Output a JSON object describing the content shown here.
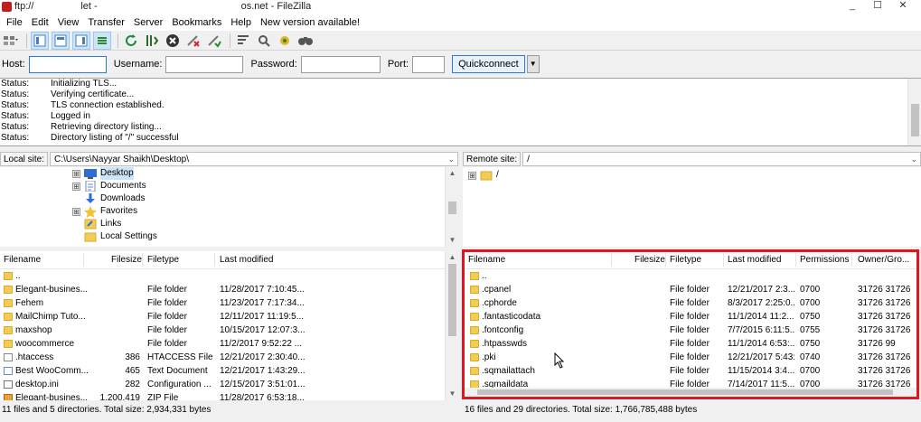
{
  "window": {
    "title": "ftp://                 let -                                                    os.net - FileZilla",
    "buttons": [
      "_",
      "☐",
      "✕"
    ]
  },
  "menu": [
    "File",
    "Edit",
    "View",
    "Transfer",
    "Server",
    "Bookmarks",
    "Help",
    "New version available!"
  ],
  "quickconnect": {
    "host_label": "Host:",
    "username_label": "Username:",
    "password_label": "Password:",
    "port_label": "Port:",
    "host_value": "",
    "username_value": "",
    "password_value": "",
    "port_value": "",
    "button_label": "Quickconnect",
    "dropdown_glyph": "▼"
  },
  "log": [
    {
      "label": "Status:",
      "text": "Initializing TLS..."
    },
    {
      "label": "Status:",
      "text": "Verifying certificate..."
    },
    {
      "label": "Status:",
      "text": "TLS connection established."
    },
    {
      "label": "Status:",
      "text": "Logged in"
    },
    {
      "label": "Status:",
      "text": "Retrieving directory listing..."
    },
    {
      "label": "Status:",
      "text": "Directory listing of \"/\" successful"
    }
  ],
  "local": {
    "site_label": "Local site:",
    "path": "C:\\Users\\Nayyar Shaikh\\Desktop\\",
    "tree": [
      {
        "label": "Desktop",
        "expander": "⊞",
        "icon": "desktop-icon"
      },
      {
        "label": "Documents",
        "expander": "⊞",
        "icon": "documents-icon"
      },
      {
        "label": "Downloads",
        "expander": "",
        "icon": "downloads-icon"
      },
      {
        "label": "Favorites",
        "expander": "⊞",
        "icon": "favorites-icon"
      },
      {
        "label": "Links",
        "expander": "",
        "icon": "links-icon"
      },
      {
        "label": "Local Settings",
        "expander": "",
        "icon": "folder-icon"
      }
    ],
    "headers": {
      "filename": "Filename",
      "filesize": "Filesize",
      "filetype": "Filetype",
      "modified": "Last modified"
    },
    "files": [
      {
        "name": "..",
        "size": "",
        "type": "",
        "modified": "",
        "icon": "up"
      },
      {
        "name": "Elegant-busines...",
        "size": "",
        "type": "File folder",
        "modified": "11/28/2017 7:10:45...",
        "icon": "folder"
      },
      {
        "name": "Fehem",
        "size": "",
        "type": "File folder",
        "modified": "11/23/2017 7:17:34...",
        "icon": "folder"
      },
      {
        "name": "MailChimp Tuto...",
        "size": "",
        "type": "File folder",
        "modified": "12/11/2017 11:19:5...",
        "icon": "folder"
      },
      {
        "name": "maxshop",
        "size": "",
        "type": "File folder",
        "modified": "10/15/2017 12:07:3...",
        "icon": "folder"
      },
      {
        "name": "woocommerce",
        "size": "",
        "type": "File folder",
        "modified": "11/2/2017 9:52:22 ...",
        "icon": "folder"
      },
      {
        "name": ".htaccess",
        "size": "386",
        "type": "HTACCESS File",
        "modified": "12/21/2017 2:30:40...",
        "icon": "file"
      },
      {
        "name": "Best WooComm...",
        "size": "465",
        "type": "Text Document",
        "modified": "12/21/2017 1:43:29...",
        "icon": "txt"
      },
      {
        "name": "desktop.ini",
        "size": "282",
        "type": "Configuration ...",
        "modified": "12/15/2017 3:51:01...",
        "icon": "ini"
      },
      {
        "name": "Elegant-busines...",
        "size": "1,200,419",
        "type": "ZIP File",
        "modified": "11/28/2017 6:53:18...",
        "icon": "zip"
      }
    ],
    "status": "11 files and 5 directories. Total size: 2,934,331 bytes"
  },
  "remote": {
    "site_label": "Remote site:",
    "path": "/",
    "tree": [
      {
        "label": "/",
        "expander": "⊞"
      }
    ],
    "headers": {
      "filename": "Filename",
      "filesize": "Filesize",
      "filetype": "Filetype",
      "modified": "Last modified",
      "permissions": "Permissions",
      "owner": "Owner/Gro..."
    },
    "files": [
      {
        "name": "..",
        "type": "",
        "modified": "",
        "perm": "",
        "owner": "",
        "icon": "up"
      },
      {
        "name": ".cpanel",
        "type": "File folder",
        "modified": "12/21/2017 2:3...",
        "perm": "0700",
        "owner": "31726 31726",
        "icon": "folder"
      },
      {
        "name": ".cphorde",
        "type": "File folder",
        "modified": "8/3/2017 2:25:0...",
        "perm": "0700",
        "owner": "31726 31726",
        "icon": "folder"
      },
      {
        "name": ".fantasticodata",
        "type": "File folder",
        "modified": "11/1/2014 11:2...",
        "perm": "0750",
        "owner": "31726 31726",
        "icon": "folder"
      },
      {
        "name": ".fontconfig",
        "type": "File folder",
        "modified": "7/7/2015 6:11:5...",
        "perm": "0755",
        "owner": "31726 31726",
        "icon": "folder"
      },
      {
        "name": ".htpasswds",
        "type": "File folder",
        "modified": "11/1/2014 6:53:...",
        "perm": "0750",
        "owner": "31726 99",
        "icon": "folder"
      },
      {
        "name": ".pki",
        "type": "File folder",
        "modified": "12/21/2017 5:43:...",
        "perm": "0740",
        "owner": "31726 31726",
        "icon": "folder"
      },
      {
        "name": ".sqmailattach",
        "type": "File folder",
        "modified": "11/15/2014 3:4...",
        "perm": "0700",
        "owner": "31726 31726",
        "icon": "folder"
      },
      {
        "name": ".sqmaildata",
        "type": "File folder",
        "modified": "7/14/2017 11:5...",
        "perm": "0700",
        "owner": "31726 31726",
        "icon": "folder"
      }
    ],
    "status": "16 files and 29 directories. Total size: 1,766,785,488 bytes"
  },
  "colors": {
    "highlight": "#e0151f",
    "folder": "#f3cc54",
    "accent": "#2b79d8"
  }
}
